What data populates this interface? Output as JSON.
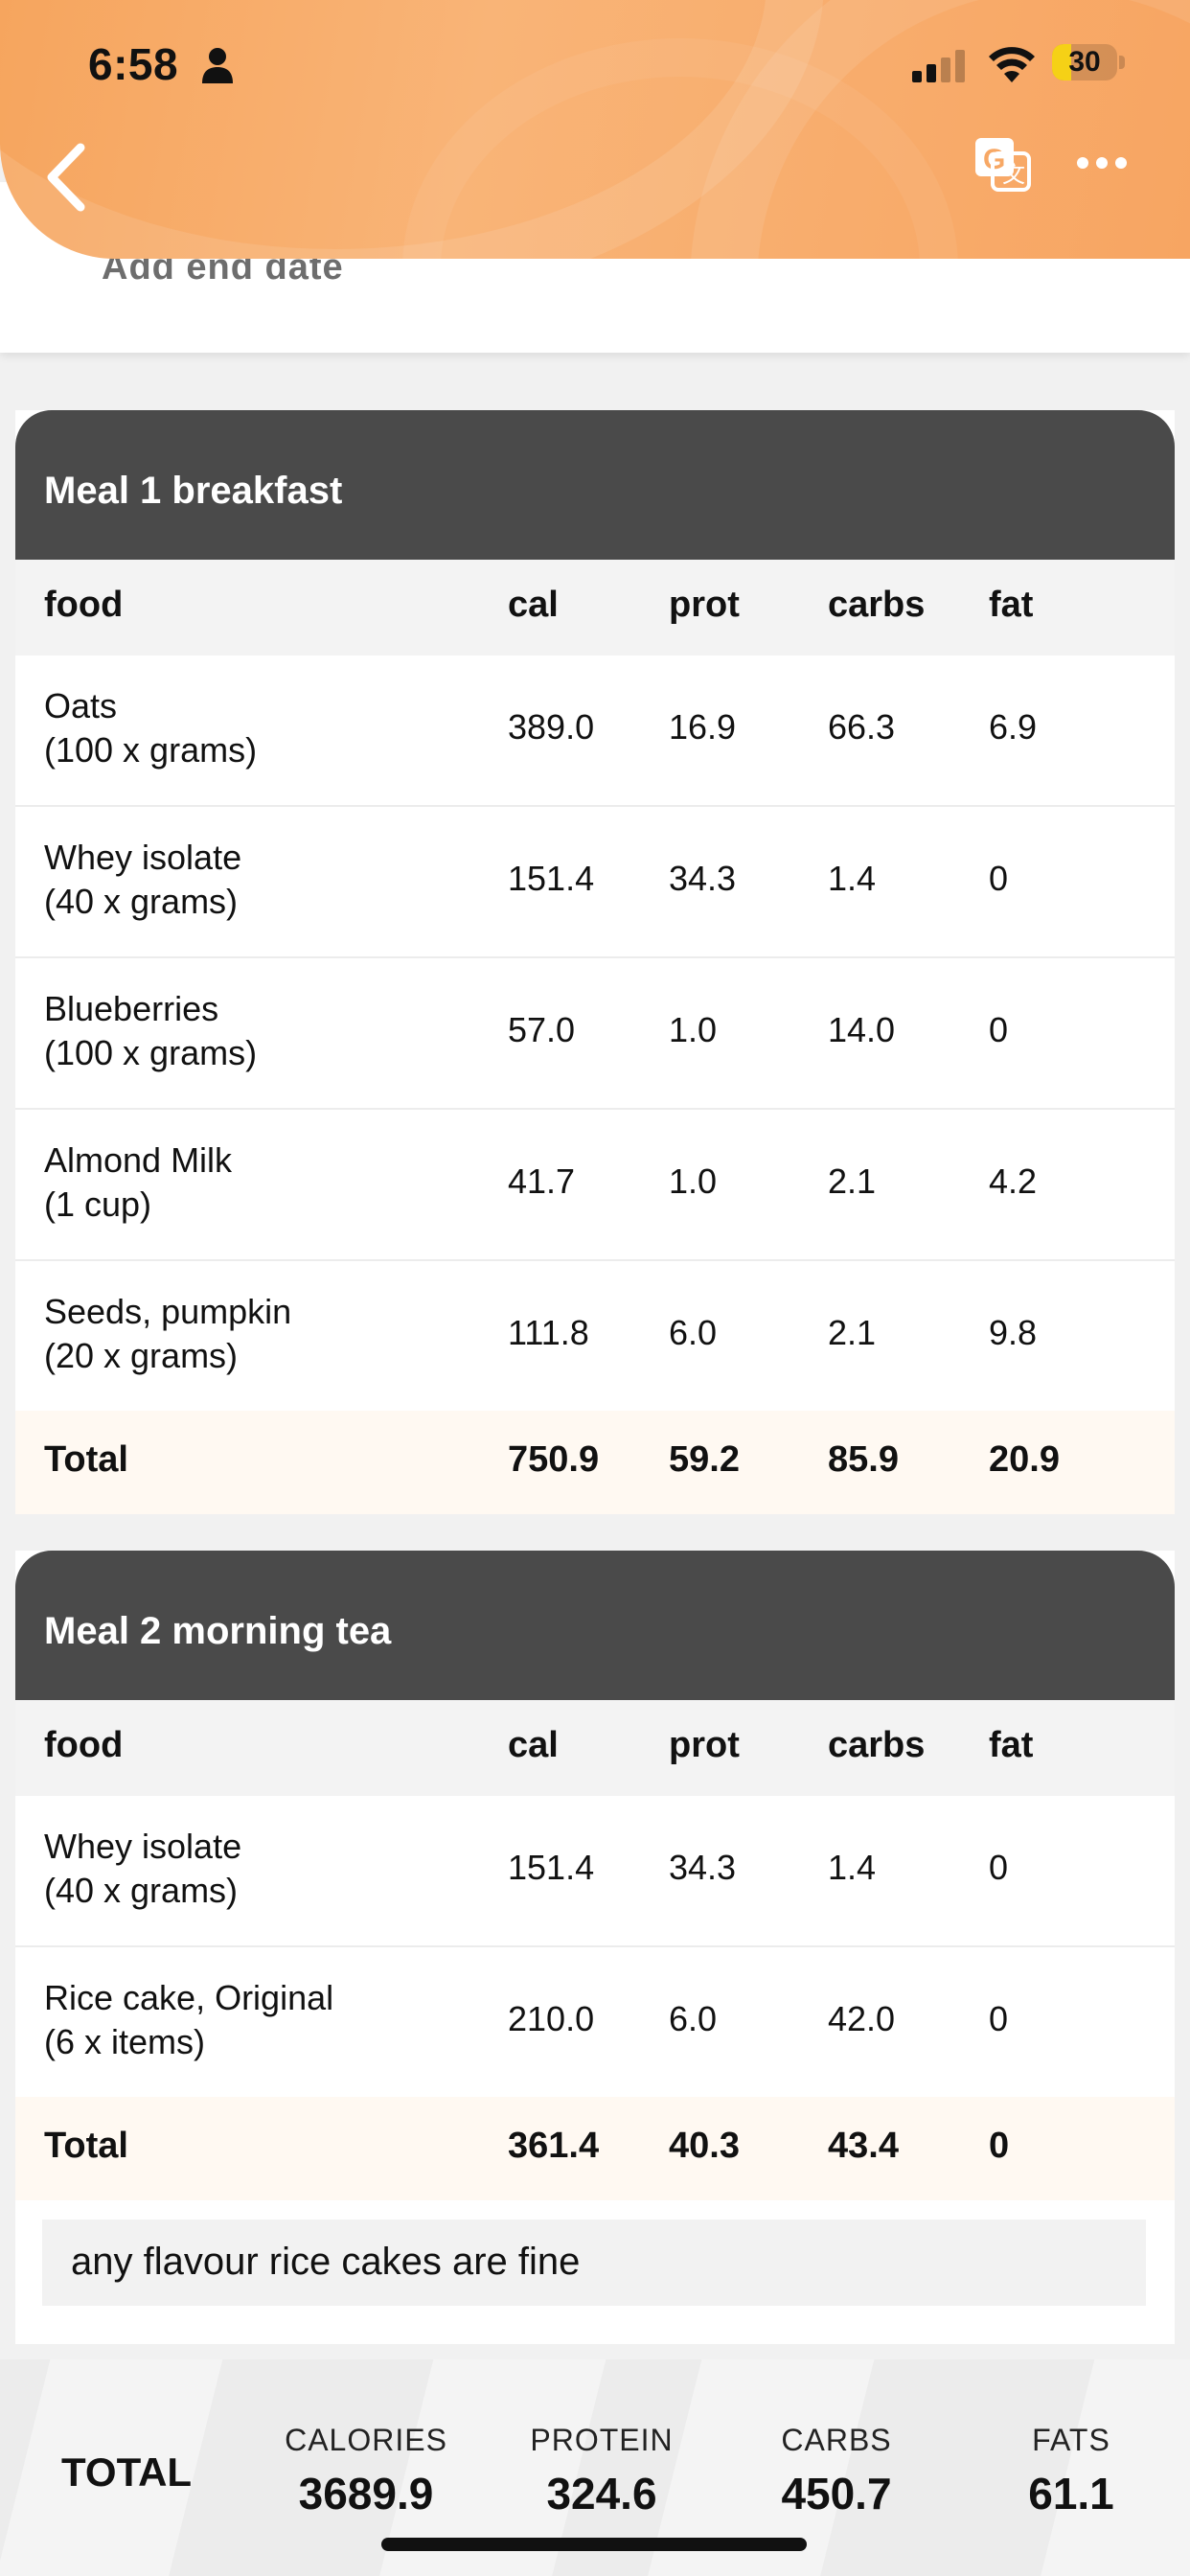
{
  "status_bar": {
    "time": "6:58",
    "battery": "30",
    "battery_level": 0.3
  },
  "date_card": {
    "add_end_date": "Add end date"
  },
  "columns": {
    "food": "food",
    "cal": "cal",
    "prot": "prot",
    "carbs": "carbs",
    "fat": "fat"
  },
  "meals": [
    {
      "title": "Meal 1 breakfast",
      "rows": [
        {
          "name": "Oats",
          "qty": "(100 x grams)",
          "cal": "389.0",
          "prot": "16.9",
          "carbs": "66.3",
          "fat": "6.9"
        },
        {
          "name": "Whey isolate",
          "qty": "(40 x grams)",
          "cal": "151.4",
          "prot": "34.3",
          "carbs": "1.4",
          "fat": "0"
        },
        {
          "name": "Blueberries",
          "qty": "(100 x grams)",
          "cal": "57.0",
          "prot": "1.0",
          "carbs": "14.0",
          "fat": "0"
        },
        {
          "name": "Almond Milk",
          "qty": "(1 cup)",
          "cal": "41.7",
          "prot": "1.0",
          "carbs": "2.1",
          "fat": "4.2"
        },
        {
          "name": "Seeds, pumpkin",
          "qty": "(20 x grams)",
          "cal": "111.8",
          "prot": "6.0",
          "carbs": "2.1",
          "fat": "9.8"
        }
      ],
      "total": {
        "label": "Total",
        "cal": "750.9",
        "prot": "59.2",
        "carbs": "85.9",
        "fat": "20.9"
      }
    },
    {
      "title": "Meal 2 morning tea",
      "rows": [
        {
          "name": "Whey isolate",
          "qty": "(40 x grams)",
          "cal": "151.4",
          "prot": "34.3",
          "carbs": "1.4",
          "fat": "0"
        },
        {
          "name": "Rice cake, Original",
          "qty": "(6 x items)",
          "cal": "210.0",
          "prot": "6.0",
          "carbs": "42.0",
          "fat": "0"
        }
      ],
      "total": {
        "label": "Total",
        "cal": "361.4",
        "prot": "40.3",
        "carbs": "43.4",
        "fat": "0"
      },
      "note": "any flavour rice cakes are fine"
    }
  ],
  "summary": {
    "label": "TOTAL",
    "calories_label": "CALORIES",
    "calories": "3689.9",
    "protein_label": "PROTEIN",
    "protein": "324.6",
    "carbs_label": "CARBS",
    "carbs": "450.7",
    "fats_label": "FATS",
    "fats": "61.1"
  },
  "colors": {
    "accent": "#f7a865",
    "meal_header": "#4a4a4a",
    "total_row": "#fff9f2"
  }
}
